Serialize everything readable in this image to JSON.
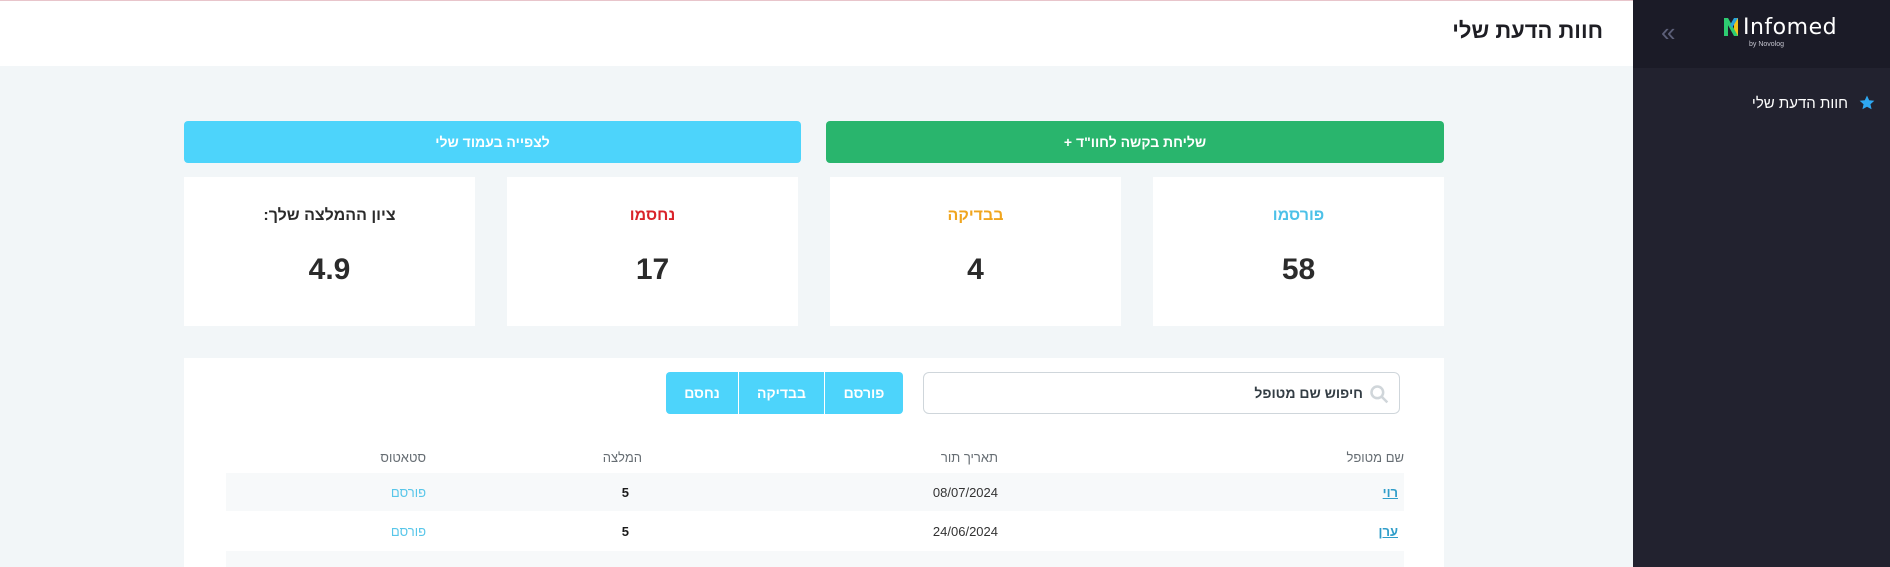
{
  "sidebar": {
    "logo": {
      "name": "Infomed",
      "sub": "by Novolog"
    },
    "collapse_icon": "double-chevron-left",
    "items": [
      {
        "label": "חוות הדעת שלי",
        "icon": "star-icon"
      }
    ]
  },
  "header": {
    "title": "חוות הדעת שלי"
  },
  "actions": {
    "send_label": "שליחת בקשה לחוו\"ד +",
    "view_label": "לצפייה בעמוד שלי"
  },
  "stats": [
    {
      "label": "פורסמו",
      "value": "58",
      "color": "#4dc1e8"
    },
    {
      "label": "בבדיקה",
      "value": "4",
      "color": "#f0a51e"
    },
    {
      "label": "נחסמו",
      "value": "17",
      "color": "#d9232a"
    },
    {
      "label": "ציון ההמלצה שלך:",
      "value": "4.9",
      "color": "#2b2b2b"
    }
  ],
  "search": {
    "placeholder": "חיפוש שם מטופל",
    "value": ""
  },
  "filters": [
    "פורסם",
    "בבדיקה",
    "נחסם"
  ],
  "table": {
    "headers": {
      "name": "שם מטופל",
      "date": "תאריך תור",
      "rec": "המלצה",
      "status": "סטאטוס"
    },
    "rows": [
      {
        "name": "רוי",
        "date": "08/07/2024",
        "rec": "5",
        "status": "פורסם"
      },
      {
        "name": "ערן",
        "date": "24/06/2024",
        "rec": "5",
        "status": "פורסם"
      }
    ]
  },
  "colors": {
    "accent": "#4dd4fb",
    "success": "#29b56d",
    "sidebar": "#22222f"
  }
}
